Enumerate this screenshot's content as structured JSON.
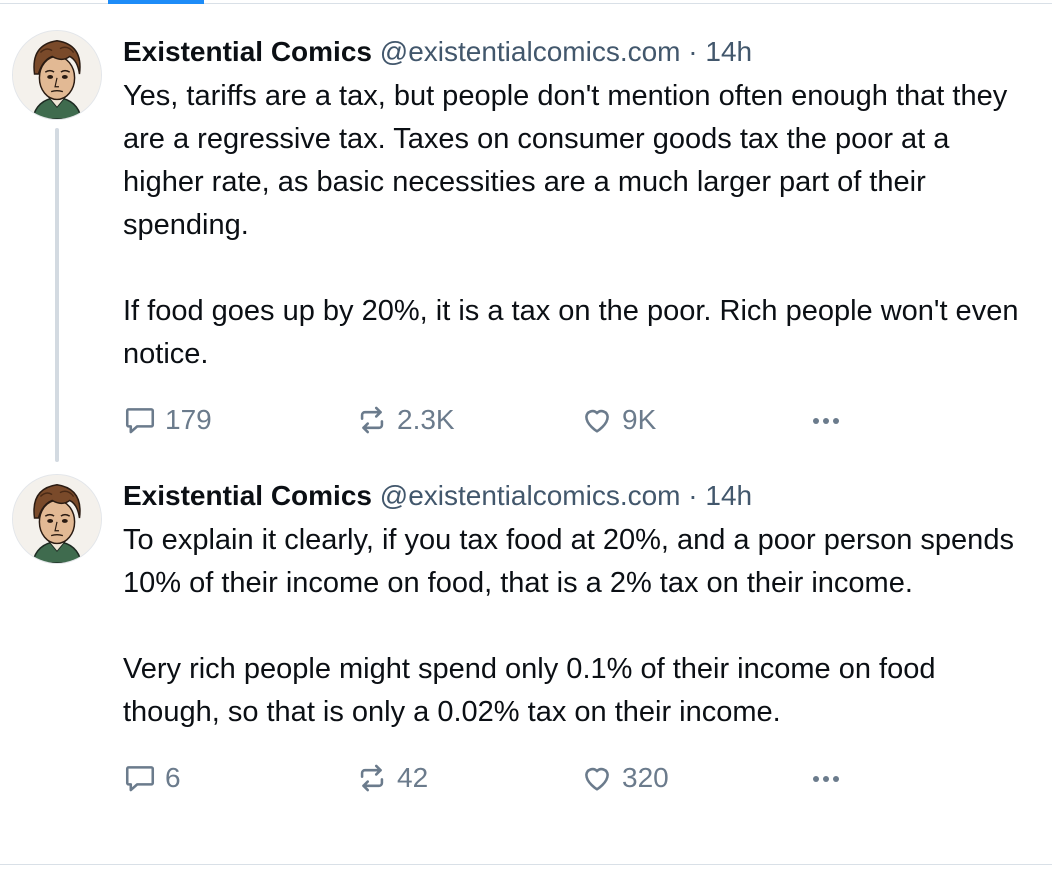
{
  "posts": [
    {
      "author": "Existential Comics",
      "handle": "@existentialcomics.com",
      "separator": "·",
      "time": "14h",
      "paragraphs": [
        "Yes, tariffs are a tax, but people don't mention often enough that they are a regressive tax. Taxes on consumer goods tax the poor at a higher rate, as basic necessities are a much larger part of their spending.",
        "If food goes up by 20%, it is a tax on the poor. Rich people won't even notice."
      ],
      "replies": "179",
      "reposts": "2.3K",
      "likes": "9K"
    },
    {
      "author": "Existential Comics",
      "handle": "@existentialcomics.com",
      "separator": "·",
      "time": "14h",
      "paragraphs": [
        "To explain it clearly, if you tax food at 20%, and a poor person spends 10% of their income on food, that is a 2% tax on their income.",
        "Very rich people might spend only 0.1% of their income on food though, so that is only a 0.02% tax on their income."
      ],
      "replies": "6",
      "reposts": "42",
      "likes": "320"
    }
  ],
  "icons": {
    "reply": "speech-bubble-icon",
    "repost": "repost-arrows-icon",
    "like": "heart-icon",
    "more": "ellipsis-icon"
  },
  "colors": {
    "accent": "#1d8cf8",
    "text": "#0b0f14",
    "muted": "#42576c",
    "action": "#6b7b8c",
    "thread_line": "#d3dae1"
  }
}
